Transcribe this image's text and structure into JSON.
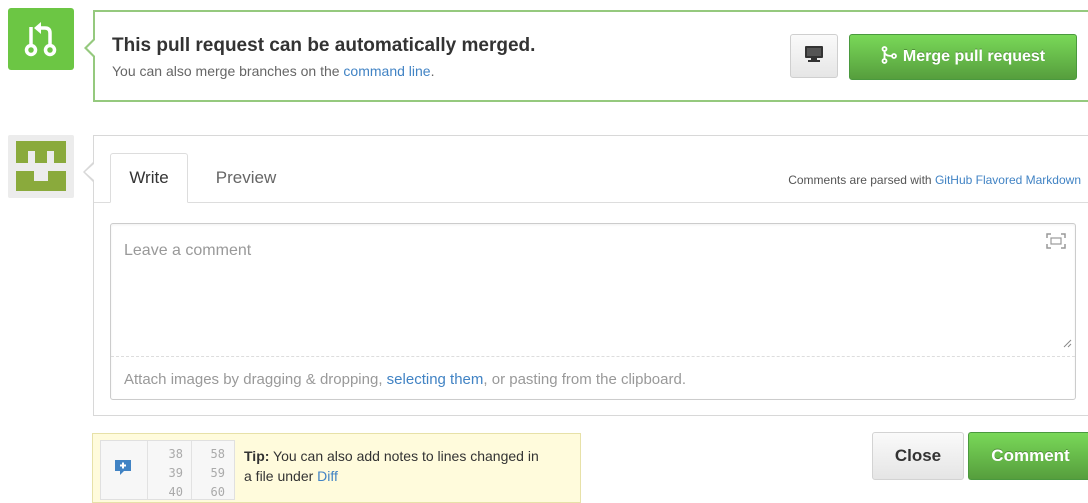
{
  "merge": {
    "icon": "git-pull-request-icon",
    "title": "This pull request can be automatically merged.",
    "subtitle_prefix": "You can also merge branches on the ",
    "subtitle_link": "command line",
    "subtitle_suffix": ".",
    "clone_icon": "desktop-icon",
    "merge_button_icon": "git-merge-icon",
    "merge_button_label": "Merge pull request"
  },
  "comment": {
    "avatar": "identicon-avatar",
    "tabs": [
      {
        "label": "Write",
        "active": true
      },
      {
        "label": "Preview",
        "active": false
      }
    ],
    "markdown_note_prefix": "Comments are parsed with ",
    "markdown_note_link": "GitHub Flavored Markdown",
    "placeholder": "Leave a comment",
    "fullscreen_icon": "fullscreen-icon",
    "attach_prefix": "Attach images by dragging & dropping, ",
    "attach_link": "selecting them",
    "attach_suffix": ", or pasting from the clipboard."
  },
  "tip": {
    "left_numbers": [
      "38",
      "39",
      "40"
    ],
    "right_numbers": [
      "58",
      "59",
      "60"
    ],
    "label": "Tip:",
    "text": " You can also add notes to lines changed in a file under ",
    "link": "Diff"
  },
  "actions": {
    "close_label": "Close",
    "comment_label": "Comment"
  },
  "colors": {
    "green": "#6cc644",
    "link": "#4183c4",
    "tip_bg": "#fffbdc"
  }
}
